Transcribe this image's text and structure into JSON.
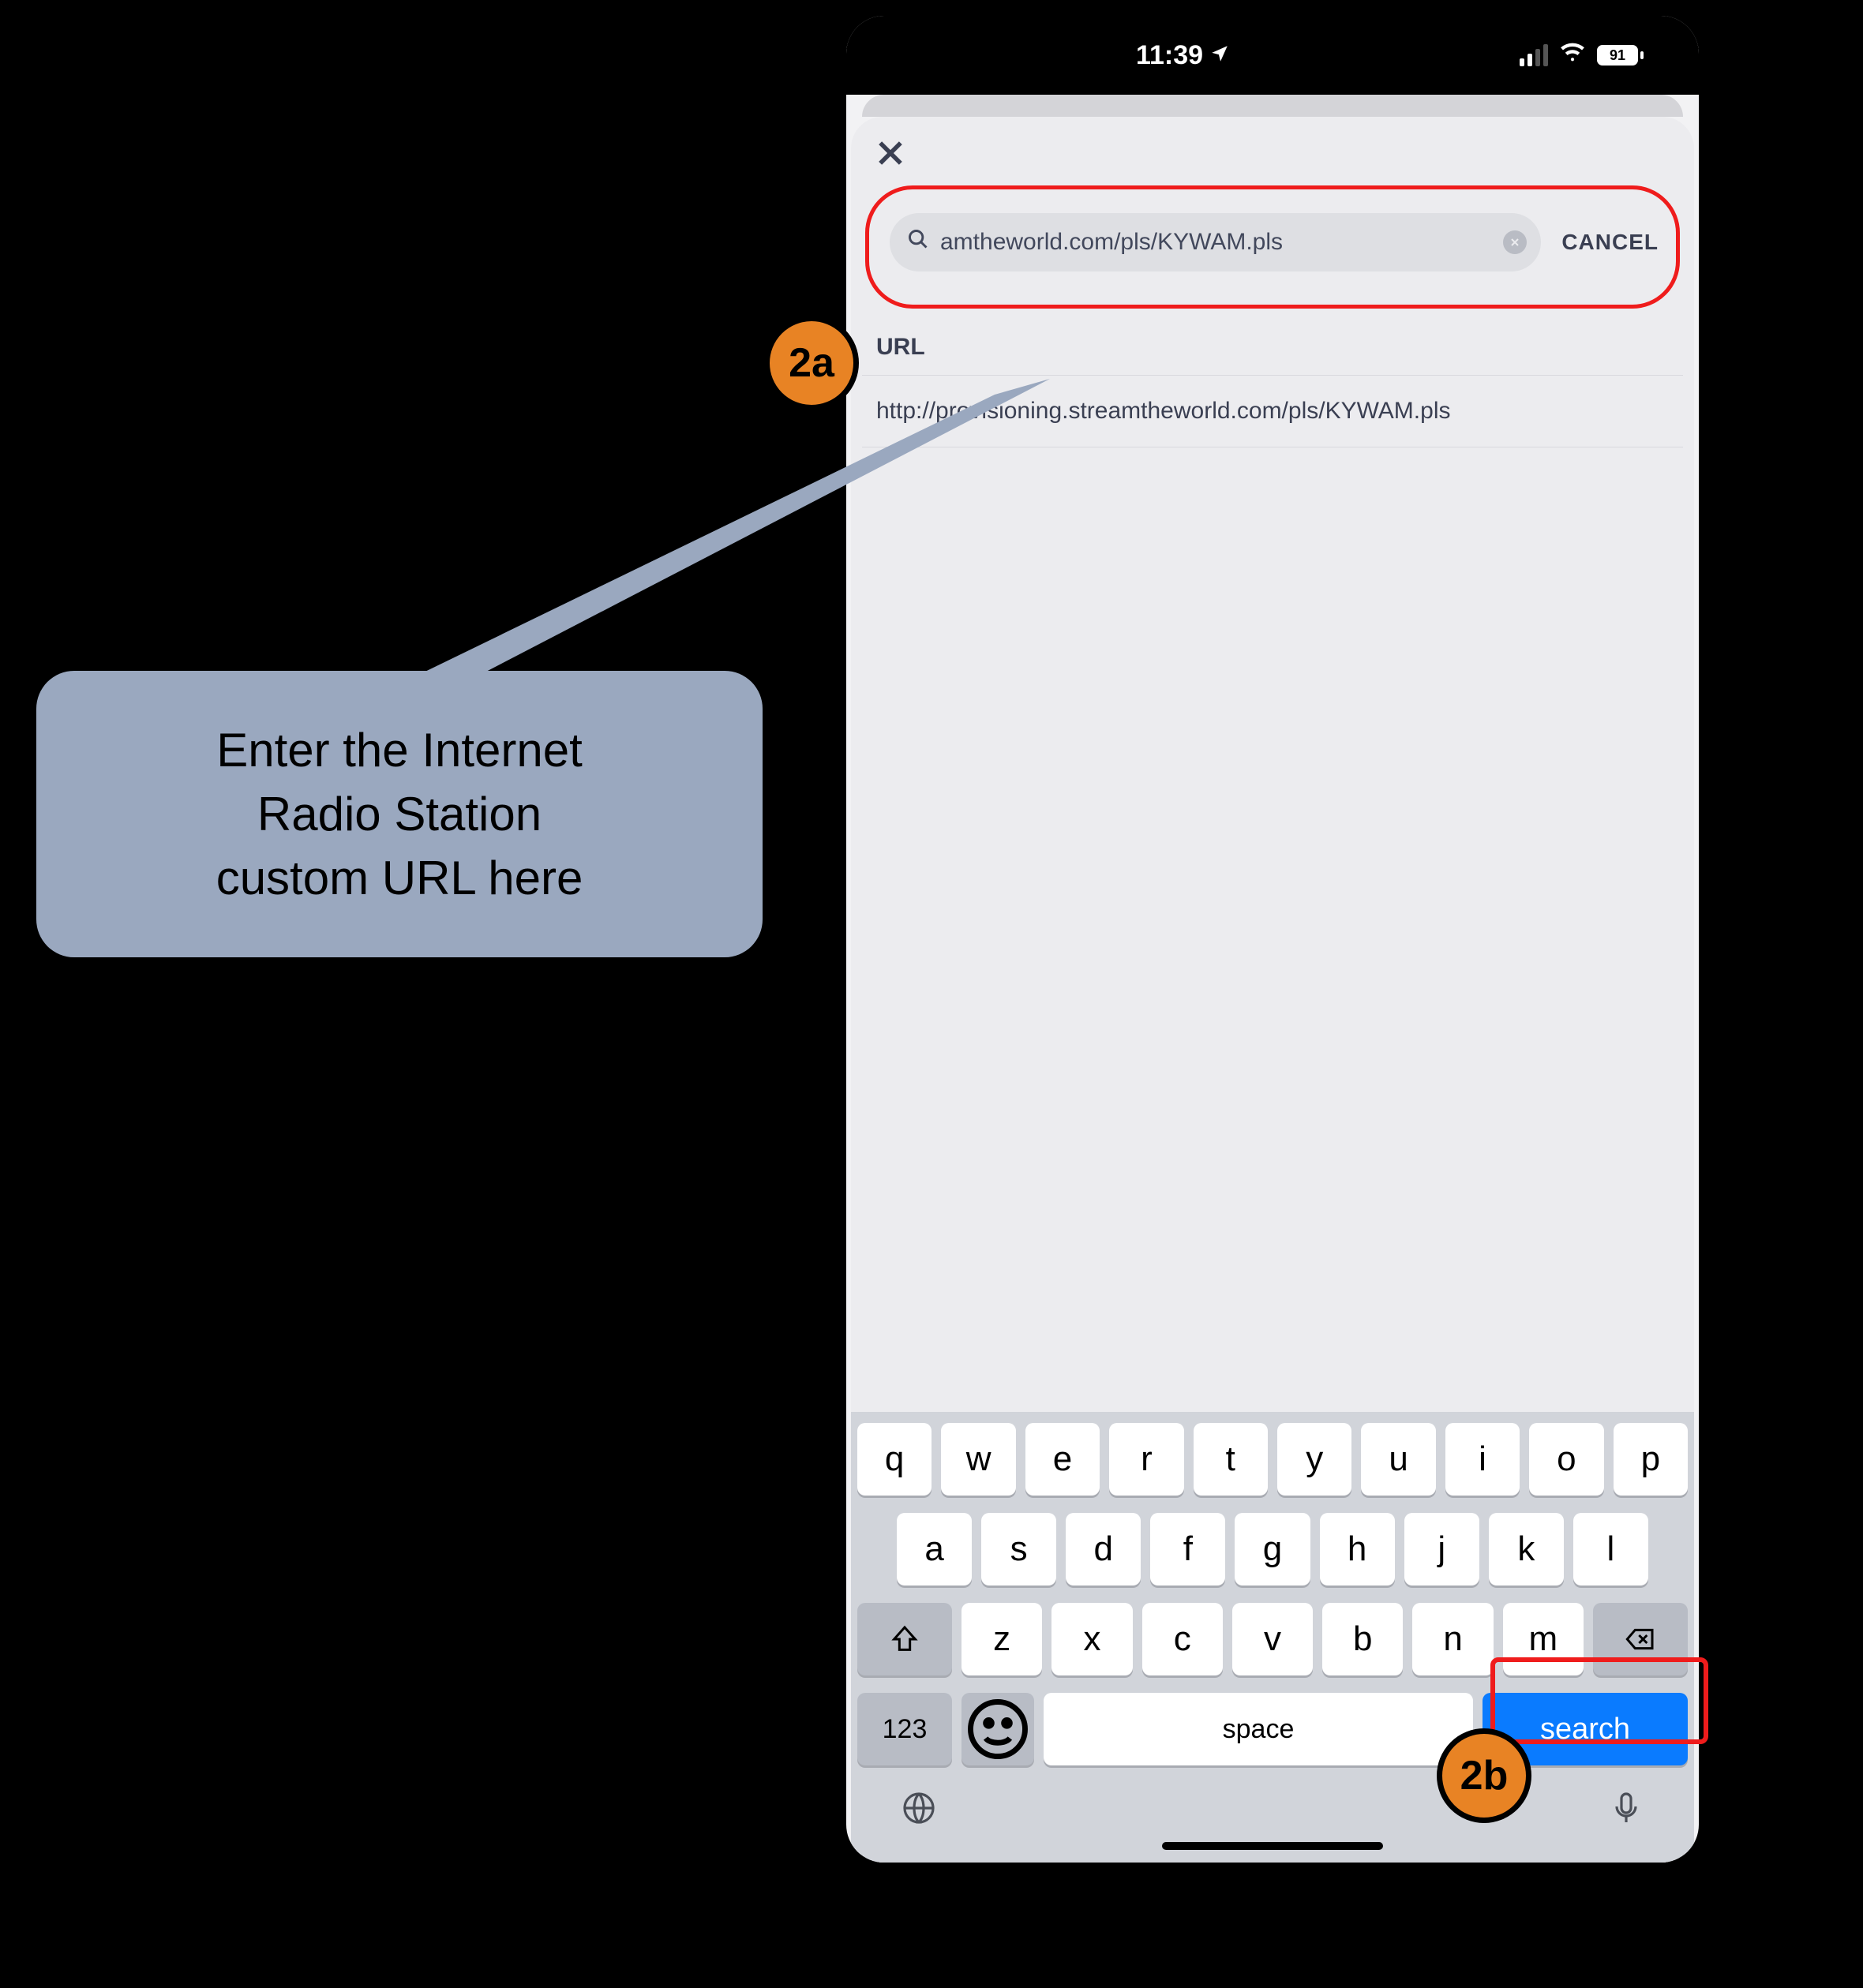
{
  "status_bar": {
    "time": "11:39",
    "battery_pct": "91"
  },
  "sheet": {
    "search_value": "amtheworld.com/pls/KYWAM.pls",
    "cancel_label": "CANCEL",
    "section_title": "URL",
    "url_value": "http://provisioning.streamtheworld.com/pls/KYWAM.pls"
  },
  "keyboard": {
    "row1": [
      "q",
      "w",
      "e",
      "r",
      "t",
      "y",
      "u",
      "i",
      "o",
      "p"
    ],
    "row2": [
      "a",
      "s",
      "d",
      "f",
      "g",
      "h",
      "j",
      "k",
      "l"
    ],
    "row3": [
      "z",
      "x",
      "c",
      "v",
      "b",
      "n",
      "m"
    ],
    "num_label": "123",
    "space_label": "space",
    "search_label": "search"
  },
  "annotations": {
    "badge_2a": "2a",
    "badge_2b": "2b",
    "callout_line1": "Enter the Internet",
    "callout_line2": "Radio Station",
    "callout_line3": "custom URL here"
  }
}
